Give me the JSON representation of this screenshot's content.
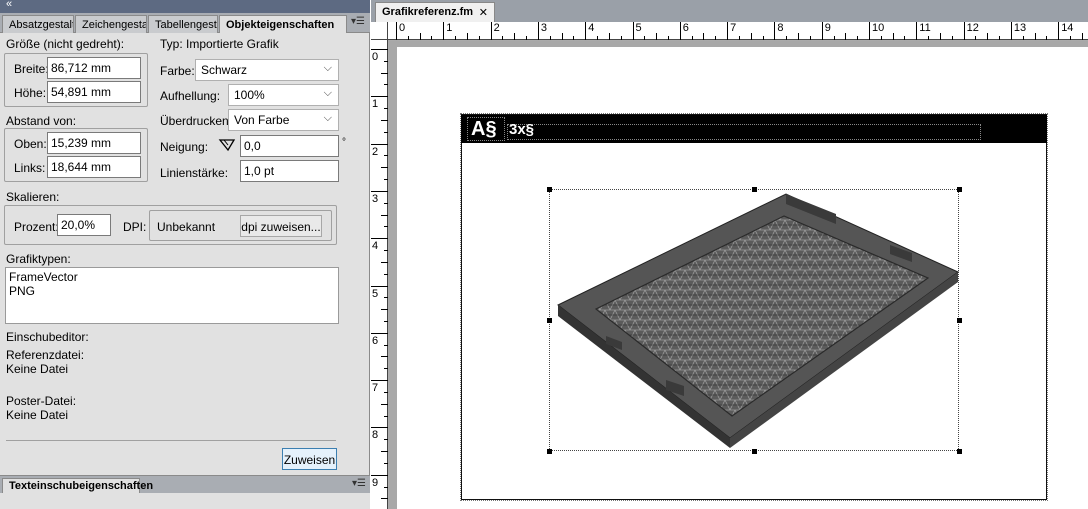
{
  "left_panel": {
    "tabs": [
      "Absatzgestalt",
      "Zeichengestalt",
      "Tabellengestal",
      "Objekteigenschaften"
    ],
    "size_group": {
      "title": "Größe (nicht gedreht):",
      "width_label": "Breite:",
      "width_value": "86,712 mm",
      "height_label": "Höhe:",
      "height_value": "54,891 mm"
    },
    "type_label": "Typ:",
    "type_value": "Importierte Grafik",
    "color_label": "Farbe:",
    "color_value": "Schwarz",
    "tint_label": "Aufhellung:",
    "tint_value": "100%",
    "overprint_label": "Überdrucken:",
    "overprint_value": "Von Farbe",
    "angle_label": "Neigung:",
    "angle_value": "0,0",
    "angle_unit": "°",
    "stroke_label": "Linienstärke:",
    "stroke_value": "1,0 pt",
    "offset_group": {
      "title": "Abstand von:",
      "top_label": "Oben:",
      "top_value": "15,239 mm",
      "left_label": "Links:",
      "left_value": "18,644 mm"
    },
    "scale_group": {
      "title": "Skalieren:",
      "percent_label": "Prozent:",
      "percent_value": "20,0%",
      "dpi_label": "DPI:",
      "dpi_value": "Unbekannt",
      "assign_dpi_button": "dpi zuweisen..."
    },
    "graphic_types_label": "Grafiktypen:",
    "graphic_types": [
      "FrameVector",
      "PNG"
    ],
    "inset_editor_label": "Einschubeditor:",
    "reference_file_label": "Referenzdatei:",
    "reference_file_value": "Keine Datei",
    "poster_file_label": "Poster-Datei:",
    "poster_file_value": "Keine Datei",
    "apply_button": "Zuweisen",
    "bottom_tab": "Texteinschubeigenschaften"
  },
  "document": {
    "tab_title": "Grafikreferenz.fm",
    "tab_close": "✕",
    "ruler_top_numbers": [
      "0",
      "1",
      "2",
      "3",
      "4",
      "5",
      "6",
      "7",
      "8",
      "9",
      "10",
      "11",
      "12",
      "13",
      "14"
    ],
    "ruler_left_numbers": [
      "0",
      "1",
      "2",
      "3",
      "4",
      "5",
      "6",
      "7",
      "8",
      "9"
    ],
    "header_text_1": "A§",
    "header_text_2": "3x§"
  },
  "icons": {
    "collapse": "double-chevron-left-icon",
    "panel_menu": "panel-menu-icon",
    "angle": "angle-icon",
    "dropdown": "chevron-down-icon"
  }
}
